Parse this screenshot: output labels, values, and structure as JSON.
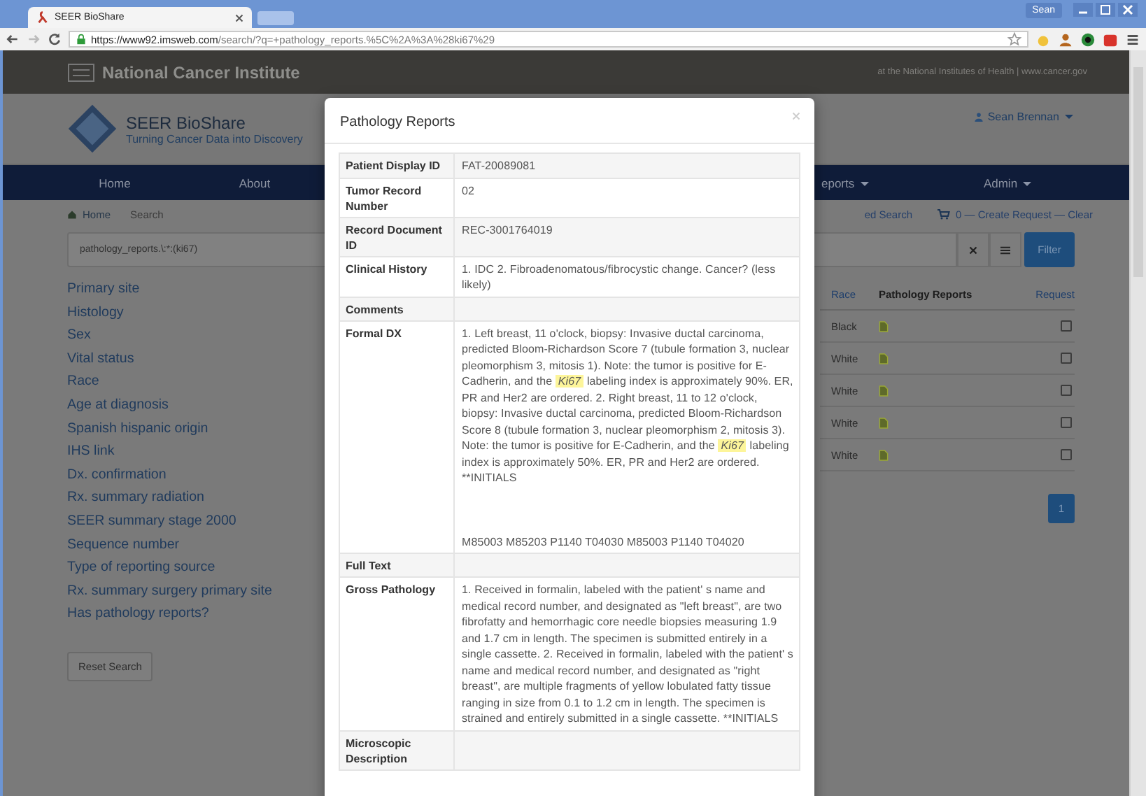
{
  "browser": {
    "tab_title": "SEER BioShare",
    "user": "Sean",
    "url_host": "https://www92.imsweb.com",
    "url_path": "/search/?q=+pathology_reports.%5C%2A%3A%28ki67%29"
  },
  "nci_bar": {
    "title": "National Cancer Institute",
    "tagline": "at the National Institutes of Health | www.cancer.gov"
  },
  "header": {
    "title": "SEER BioShare",
    "subtitle": "Turning Cancer Data into Discovery",
    "user": "Sean Brennan"
  },
  "nav": {
    "left_items": [
      "Home",
      "About"
    ],
    "right_items": [
      "eports",
      "Admin"
    ]
  },
  "breadcrumb": [
    "Home",
    "Search"
  ],
  "actions": {
    "advanced": "ed Search",
    "cart": "0 — Create Request — Clear"
  },
  "search": {
    "value": "pathology_reports.\\:*:(ki67)",
    "filter_button": "Filter"
  },
  "facets": [
    "Primary site",
    "Histology",
    "Sex",
    "Vital status",
    "Race",
    "Age at diagnosis",
    "Spanish hispanic origin",
    "IHS link",
    "Dx. confirmation",
    "Rx. summary radiation",
    "SEER summary stage 2000",
    "Sequence number",
    "Type of reporting source",
    "Rx. summary surgery primary site",
    "Has pathology reports?"
  ],
  "reset_button": "Reset Search",
  "results": {
    "columns": [
      "Race",
      "Pathology Reports",
      "Request"
    ],
    "rows": [
      {
        "race": "Black",
        "checked": false
      },
      {
        "race": "White",
        "checked": false
      },
      {
        "race": "White",
        "checked": false
      },
      {
        "race": "White",
        "checked": false
      },
      {
        "race": "White",
        "checked": false
      }
    ],
    "pages": [
      {
        "label": "1",
        "selected": true
      }
    ]
  },
  "modal": {
    "title": "Pathology Reports",
    "fields": [
      {
        "label": "Patient Display ID",
        "paragraphs": [
          [
            {
              "text": "FAT-20089081",
              "highlight": false
            }
          ]
        ]
      },
      {
        "label": "Tumor Record Number",
        "paragraphs": [
          [
            {
              "text": "02",
              "highlight": false
            }
          ]
        ]
      },
      {
        "label": "Record Document ID",
        "paragraphs": [
          [
            {
              "text": "REC-3001764019",
              "highlight": false
            }
          ]
        ]
      },
      {
        "label": "Clinical History",
        "paragraphs": [
          [
            {
              "text": "1. IDC 2. Fibroadenomatous/fibrocystic change. Cancer? (less likely)",
              "highlight": false
            }
          ]
        ]
      },
      {
        "label": "Comments"
      },
      {
        "label": "Formal DX",
        "paragraphs": [
          [
            {
              "text": "1. Left breast, 11 o'clock, biopsy: Invasive ductal carcinoma, predicted Bloom-Richardson Score 7 (tubule formation 3, nuclear pleomorphism 3, mitosis 1). Note: the tumor is positive for E-Cadherin, and the ",
              "highlight": false
            },
            {
              "text": "Ki67",
              "highlight": true
            },
            {
              "text": " labeling index is approximately 90%. ER, PR and Her2 are ordered. 2. Right breast, 11 to 12 o'clock, biopsy: Invasive ductal carcinoma, predicted Bloom-Richardson Score 8 (tubule formation 3, nuclear pleomorphism 2, mitosis 3). Note: the tumor is positive for E-Cadherin, and the ",
              "highlight": false
            },
            {
              "text": "Ki67",
              "highlight": true
            },
            {
              "text": " labeling index is approximately 50%. ER, PR and Her2 are ordered. **INITIALS",
              "highlight": false
            }
          ],
          [
            {
              "text": "M85003 M85203 P1140 T04030 M85003 P1140 T04020",
              "highlight": false
            }
          ]
        ]
      },
      {
        "label": "Full Text"
      },
      {
        "label": "Gross Pathology",
        "paragraphs": [
          [
            {
              "text": "1. Received in formalin, labeled with the patient' s name and medical record number, and designated as \"left breast\", are two fibrofatty and hemorrhagic core needle biopsies measuring 1.9 and 1.7 cm in length. The specimen is submitted entirely in a single cassette. 2. Received in formalin, labeled with the patient' s name and medical record number, and designated as \"right breast\", are multiple fragments of yellow lobulated fatty tissue ranging in size from 0.1 to 1.2 cm in length. The specimen is strained and entirely submitted in a single cassette. **INITIALS",
              "highlight": false
            }
          ]
        ]
      },
      {
        "label": "Microscopic Description"
      }
    ]
  }
}
